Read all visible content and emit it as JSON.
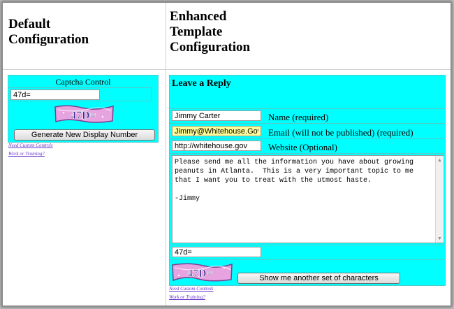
{
  "left": {
    "heading_line1": "Default",
    "heading_line2": "Configuration",
    "captcha_title": "Captcha Control",
    "captcha_value": "47d=",
    "captcha_image_text": "47D=",
    "button_label": "Generate New Display Number",
    "link1": "Need Custom Controls",
    "link2": "Work or Training?"
  },
  "right": {
    "heading_line1": "Enhanced",
    "heading_line2": "Template",
    "heading_line3": "Configuration",
    "reply_title": "Leave a Reply",
    "name_value": "Jimmy Carter",
    "name_label": "Name (required)",
    "email_value": "Jimmy@Whitehouse.Gov",
    "email_label": "Email (will not be published) (required)",
    "website_value": "http://whitehouse.gov",
    "website_label": "Website (Optional)",
    "message": "Please send me all the information you have about growing\npeanuts in Atlanta.  This is a very important topic to me\nthat I want you to treat with the utmost haste.\n\n-Jimmy",
    "captcha_value": "47d=",
    "captcha_image_text": "47D=",
    "button_label": "Show me another set of characters",
    "link1": "Need Custom Controls",
    "link2": "Work or Training?"
  },
  "colors": {
    "panel": "#00ffff",
    "email_highlight": "#ffff99",
    "link": "#6633cc"
  }
}
